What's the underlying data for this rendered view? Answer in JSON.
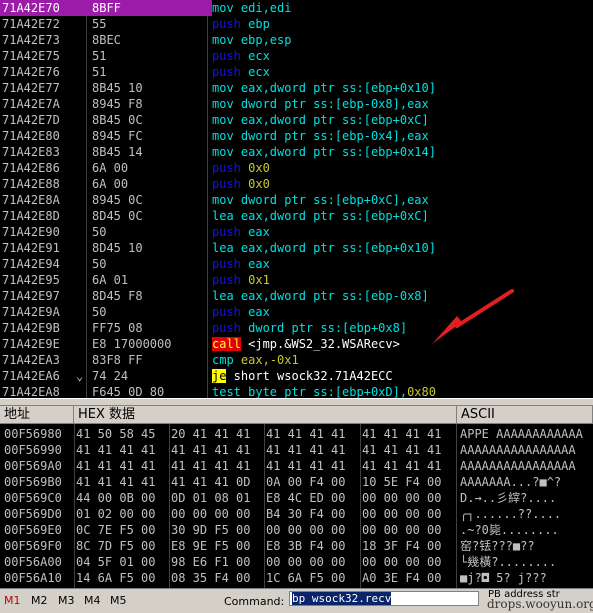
{
  "disasm": {
    "rows": [
      {
        "addr": "71A42E70",
        "hex": "8BFF",
        "asm": [
          [
            "mov",
            "t-cyan"
          ],
          [
            " edi,edi",
            "t-cyan"
          ]
        ],
        "selected": true
      },
      {
        "addr": "71A42E72",
        "hex": "55",
        "asm": [
          [
            "push",
            "t-blue"
          ],
          [
            " ebp",
            "t-cyan"
          ]
        ]
      },
      {
        "addr": "71A42E73",
        "hex": "8BEC",
        "asm": [
          [
            "mov",
            "t-cyan"
          ],
          [
            " ebp,esp",
            "t-cyan"
          ]
        ]
      },
      {
        "addr": "71A42E75",
        "hex": "51",
        "asm": [
          [
            "push",
            "t-blue"
          ],
          [
            " ecx",
            "t-cyan"
          ]
        ]
      },
      {
        "addr": "71A42E76",
        "hex": "51",
        "asm": [
          [
            "push",
            "t-blue"
          ],
          [
            " ecx",
            "t-cyan"
          ]
        ]
      },
      {
        "addr": "71A42E77",
        "hex": "8B45 10",
        "asm": [
          [
            "mov",
            "t-cyan"
          ],
          [
            " eax,dword ptr ss:[ebp+0x10]",
            "t-cyan"
          ]
        ]
      },
      {
        "addr": "71A42E7A",
        "hex": "8945 F8",
        "asm": [
          [
            "mov",
            "t-cyan"
          ],
          [
            " dword ptr ss:[ebp-0x8],eax",
            "t-cyan"
          ]
        ]
      },
      {
        "addr": "71A42E7D",
        "hex": "8B45 0C",
        "asm": [
          [
            "mov",
            "t-cyan"
          ],
          [
            " eax,dword ptr ss:[ebp+0xC]",
            "t-cyan"
          ]
        ]
      },
      {
        "addr": "71A42E80",
        "hex": "8945 FC",
        "asm": [
          [
            "mov",
            "t-cyan"
          ],
          [
            " dword ptr ss:[ebp-0x4],eax",
            "t-cyan"
          ]
        ]
      },
      {
        "addr": "71A42E83",
        "hex": "8B45 14",
        "asm": [
          [
            "mov",
            "t-cyan"
          ],
          [
            " eax,dword ptr ss:[ebp+0x14]",
            "t-cyan"
          ]
        ]
      },
      {
        "addr": "71A42E86",
        "hex": "6A 00",
        "asm": [
          [
            "push",
            "t-blue"
          ],
          [
            " 0x0",
            "t-gold"
          ]
        ]
      },
      {
        "addr": "71A42E88",
        "hex": "6A 00",
        "asm": [
          [
            "push",
            "t-blue"
          ],
          [
            " 0x0",
            "t-gold"
          ]
        ]
      },
      {
        "addr": "71A42E8A",
        "hex": "8945 0C",
        "asm": [
          [
            "mov",
            "t-cyan"
          ],
          [
            " dword ptr ss:[ebp+0xC],eax",
            "t-cyan"
          ]
        ]
      },
      {
        "addr": "71A42E8D",
        "hex": "8D45 0C",
        "asm": [
          [
            "lea",
            "t-cyan"
          ],
          [
            " eax,dword ptr ss:[ebp+0xC]",
            "t-cyan"
          ]
        ]
      },
      {
        "addr": "71A42E90",
        "hex": "50",
        "asm": [
          [
            "push",
            "t-blue"
          ],
          [
            " eax",
            "t-cyan"
          ]
        ]
      },
      {
        "addr": "71A42E91",
        "hex": "8D45 10",
        "asm": [
          [
            "lea",
            "t-cyan"
          ],
          [
            " eax,dword ptr ss:[ebp+0x10]",
            "t-cyan"
          ]
        ]
      },
      {
        "addr": "71A42E94",
        "hex": "50",
        "asm": [
          [
            "push",
            "t-blue"
          ],
          [
            " eax",
            "t-cyan"
          ]
        ]
      },
      {
        "addr": "71A42E95",
        "hex": "6A 01",
        "asm": [
          [
            "push",
            "t-blue"
          ],
          [
            " 0x1",
            "t-gold"
          ]
        ]
      },
      {
        "addr": "71A42E97",
        "hex": "8D45 F8",
        "asm": [
          [
            "lea",
            "t-cyan"
          ],
          [
            " eax,dword ptr ss:[ebp-0x8]",
            "t-cyan"
          ]
        ]
      },
      {
        "addr": "71A42E9A",
        "hex": "50",
        "asm": [
          [
            "push",
            "t-blue"
          ],
          [
            " eax",
            "t-cyan"
          ]
        ]
      },
      {
        "addr": "71A42E9B",
        "hex": "FF75 08",
        "asm": [
          [
            "push",
            "t-blue"
          ],
          [
            " dword ptr ss:[ebp+0x8]",
            "t-cyan"
          ]
        ]
      },
      {
        "addr": "71A42E9E",
        "hex": "E8 17000000",
        "asm": [
          [
            "call",
            "kw-call"
          ],
          [
            " <jmp.&WS2_32.WSARecv>",
            "t-white"
          ]
        ]
      },
      {
        "addr": "71A42EA3",
        "hex": "83F8 FF",
        "asm": [
          [
            "cmp",
            "t-cyan"
          ],
          [
            " eax,-0x1",
            "t-gold"
          ]
        ]
      },
      {
        "addr": "71A42EA6",
        "hex": "74 24",
        "jmark": "⌄",
        "asm": [
          [
            "je",
            "kw-jcc"
          ],
          [
            " short wsock32.71A42ECC",
            "t-white"
          ]
        ]
      },
      {
        "addr": "71A42EA8",
        "hex": "F645 0D 80",
        "asm": [
          [
            "test",
            "t-cyan"
          ],
          [
            " byte ptr ss:[ebp+0xD],",
            "t-cyan"
          ],
          [
            "0x80",
            "t-gold"
          ]
        ]
      }
    ]
  },
  "dump": {
    "header": {
      "addr": "地址",
      "hex": "HEX 数据",
      "ascii": "ASCII"
    },
    "rows": [
      {
        "addr": "00F56980",
        "g": [
          "41 50 58 45",
          "20 41 41 41",
          "41 41 41 41",
          "41 41 41 41"
        ],
        "ascii": "APPE AAAAAAAAAAAA"
      },
      {
        "addr": "00F56990",
        "g": [
          "41 41 41 41",
          "41 41 41 41",
          "41 41 41 41",
          "41 41 41 41"
        ],
        "ascii": "AAAAAAAAAAAAAAAA"
      },
      {
        "addr": "00F569A0",
        "g": [
          "41 41 41 41",
          "41 41 41 41",
          "41 41 41 41",
          "41 41 41 41"
        ],
        "ascii": "AAAAAAAAAAAAAAAA"
      },
      {
        "addr": "00F569B0",
        "g": [
          "41 41 41 41",
          "41 41 41 0D",
          "0A 00 F4 00",
          "10 5E F4 00"
        ],
        "ascii": "AAAAAAA...?■^?"
      },
      {
        "addr": "00F569C0",
        "g": [
          "44 00 0B 00",
          "0D 01 08 01",
          "E8 4C ED 00",
          "00 00 00 00"
        ],
        "ascii": "D.→..彡縡?...."
      },
      {
        "addr": "00F569D0",
        "g": [
          "01 02 00 00",
          "00 00 00 00",
          "B4 30 F4 00",
          "00 00 00 00"
        ],
        "ascii": "╭┐......??...."
      },
      {
        "addr": "00F569E0",
        "g": [
          "0C 7E F5 00",
          "30 9D F5 00",
          "00 00 00 00",
          "00 00 00 00"
        ],
        "ascii": ".~?0毙........"
      },
      {
        "addr": "00F569F0",
        "g": [
          "8C 7D F5 00",
          "E8 9E F5 00",
          "E8 3B F4 00",
          "18 3F F4 00"
        ],
        "ascii": "窑?铥???■??"
      },
      {
        "addr": "00F56A00",
        "g": [
          "04 5F 01 00",
          "98 E6 F1 00",
          "00 00 00 00",
          "00 00 00 00"
        ],
        "ascii": "└幾橫?........"
      },
      {
        "addr": "00F56A10",
        "g": [
          "14 6A F5 00",
          "08 35 F4 00",
          "1C 6A F5 00",
          "A0 3E F4 00"
        ],
        "ascii": "■j?◘ 5? j???"
      }
    ]
  },
  "status": {
    "tabs": [
      "M1",
      "M2",
      "M3",
      "M4",
      "M5"
    ],
    "active_tab": "M1",
    "command_label": "Command:",
    "command_value": "bp wsock32.recv",
    "right_text": "PB address   str",
    "watermark": "drops.wooyun.org"
  }
}
